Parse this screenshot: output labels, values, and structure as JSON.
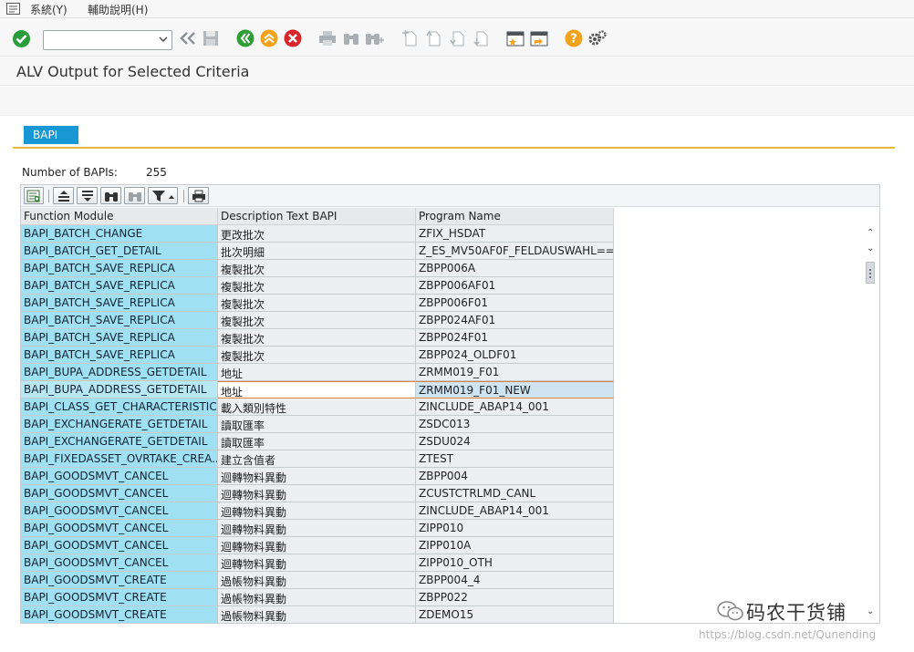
{
  "menu": {
    "items": [
      "系統(Y)",
      "輔助說明(H)"
    ]
  },
  "toolbar": {
    "command_value": "",
    "icons": [
      "enter-check-icon",
      "dropdown-chevron-icon",
      "double-back-icon",
      "save-icon",
      "back-icon",
      "exit-icon",
      "cancel-icon",
      "print-icon",
      "find-icon",
      "find-next-icon",
      "first-page-icon",
      "previous-page-icon",
      "next-page-icon",
      "last-page-icon",
      "create-session-icon",
      "shortcut-icon",
      "help-icon",
      "settings-icon"
    ],
    "colors": {
      "enter": "#2a9d3a",
      "nav_green": "#2f9e37",
      "up_orange": "#f2a21b",
      "cancel_red": "#d9262b",
      "help_yellow": "#f2a21b"
    }
  },
  "page": {
    "title": "ALV Output for Selected Criteria"
  },
  "tab": {
    "label": "BAPI",
    "color": "#1797d4"
  },
  "summary": {
    "label": "Number of BAPIs:",
    "value": "255"
  },
  "alv": {
    "toolbar_icons": [
      "details-icon",
      "sort-ascending-icon",
      "sort-descending-icon",
      "find-icon",
      "find-next-icon",
      "filter-icon",
      "print-preview-icon"
    ],
    "columns": [
      "Function Module",
      "Description Text BAPI",
      "Program Name"
    ],
    "rows": [
      [
        "BAPI_BATCH_CHANGE",
        "更改批次",
        "ZFIX_HSDAT"
      ],
      [
        "BAPI_BATCH_GET_DETAIL",
        "批次明細",
        "Z_ES_MV50AF0F_FELDAUSWAHL==..."
      ],
      [
        "BAPI_BATCH_SAVE_REPLICA",
        "複製批次",
        "ZBPP006A"
      ],
      [
        "BAPI_BATCH_SAVE_REPLICA",
        "複製批次",
        "ZBPP006AF01"
      ],
      [
        "BAPI_BATCH_SAVE_REPLICA",
        "複製批次",
        "ZBPP006F01"
      ],
      [
        "BAPI_BATCH_SAVE_REPLICA",
        "複製批次",
        "ZBPP024AF01"
      ],
      [
        "BAPI_BATCH_SAVE_REPLICA",
        "複製批次",
        "ZBPP024F01"
      ],
      [
        "BAPI_BATCH_SAVE_REPLICA",
        "複製批次",
        "ZBPP024_OLDF01"
      ],
      [
        "BAPI_BUPA_ADDRESS_GETDETAIL",
        "地址",
        "ZRMM019_F01"
      ],
      [
        "BAPI_BUPA_ADDRESS_GETDETAIL",
        "地址",
        "ZRMM019_F01_NEW"
      ],
      [
        "BAPI_CLASS_GET_CHARACTERISTICS",
        "載入類別特性",
        "ZINCLUDE_ABAP14_001"
      ],
      [
        "BAPI_EXCHANGERATE_GETDETAIL",
        "讀取匯率",
        "ZSDC013"
      ],
      [
        "BAPI_EXCHANGERATE_GETDETAIL",
        "讀取匯率",
        "ZSDU024"
      ],
      [
        "BAPI_FIXEDASSET_OVRTAKE_CREA...",
        "建立含值者",
        "ZTEST"
      ],
      [
        "BAPI_GOODSMVT_CANCEL",
        "迴轉物料異動",
        "ZBPP004"
      ],
      [
        "BAPI_GOODSMVT_CANCEL",
        "迴轉物料異動",
        "ZCUSTCTRLMD_CANL"
      ],
      [
        "BAPI_GOODSMVT_CANCEL",
        "迴轉物料異動",
        "ZINCLUDE_ABAP14_001"
      ],
      [
        "BAPI_GOODSMVT_CANCEL",
        "迴轉物料異動",
        "ZIPP010"
      ],
      [
        "BAPI_GOODSMVT_CANCEL",
        "迴轉物料異動",
        "ZIPP010A"
      ],
      [
        "BAPI_GOODSMVT_CANCEL",
        "迴轉物料異動",
        "ZIPP010_OTH"
      ],
      [
        "BAPI_GOODSMVT_CREATE",
        "過帳物料異動",
        "ZBPP004_4"
      ],
      [
        "BAPI_GOODSMVT_CREATE",
        "過帳物料異動",
        "ZBPP022"
      ],
      [
        "BAPI_GOODSMVT_CREATE",
        "過帳物料異動",
        "ZDEMO15"
      ]
    ],
    "selected_row": 9,
    "colors": {
      "key_column": "#9fe0f2",
      "cell": "#eceef0",
      "selection_border": "#e0823a"
    }
  },
  "watermark": {
    "brand": "码农干货铺",
    "url": "https://blog.csdn.net/Qunending"
  }
}
